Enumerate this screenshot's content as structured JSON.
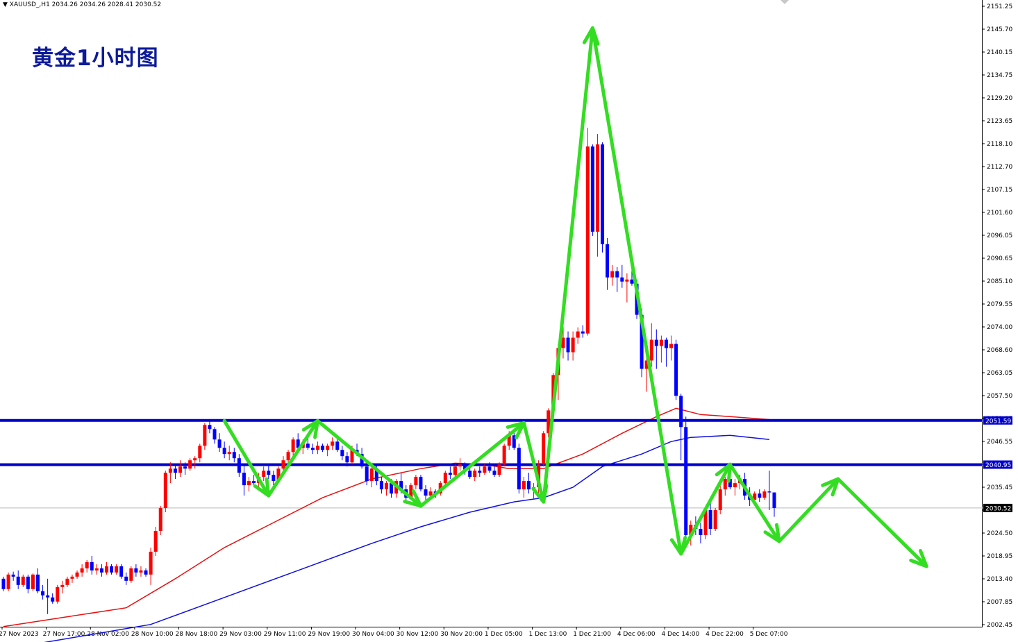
{
  "header": {
    "symbol": "XAUUSD_,H1",
    "ohlc": "2034.26 2034.26 2028.41 2030.52",
    "title": "黄金1小时图"
  },
  "colors": {
    "bull": "#ff0000",
    "bear": "#0000ff",
    "ma_red": "#e81010",
    "ma_blue": "#1010e0",
    "level_line": "#0000cc",
    "arrow": "#33dd22",
    "title": "#0d1a9a"
  },
  "chart_data": {
    "type": "candlestick",
    "ylim": [
      2002.45,
      2151.25
    ],
    "y_ticks": [
      "2151.25",
      "2145.70",
      "2140.15",
      "2134.75",
      "2129.20",
      "2123.65",
      "2118.10",
      "2112.70",
      "2107.15",
      "2101.60",
      "2096.05",
      "2090.65",
      "2085.10",
      "2079.55",
      "2074.00",
      "2068.60",
      "2063.05",
      "2057.50",
      "2051.95",
      "2046.55",
      "2041.00",
      "2035.45",
      "2029.90",
      "2024.50",
      "2018.95",
      "2013.40",
      "2007.85",
      "2002.45"
    ],
    "x_ticks": [
      "27 Nov 2023",
      "27 Nov 17:00",
      "28 Nov 02:00",
      "28 Nov 10:00",
      "28 Nov 18:00",
      "29 Nov 03:00",
      "29 Nov 11:00",
      "29 Nov 19:00",
      "30 Nov 04:00",
      "30 Nov 12:00",
      "30 Nov 20:00",
      "1 Dec 05:00",
      "1 Dec 13:00",
      "1 Dec 21:00",
      "4 Dec 06:00",
      "4 Dec 14:00",
      "4 Dec 22:00",
      "5 Dec 07:00"
    ],
    "x_tick_index": [
      0,
      9,
      18,
      27,
      36,
      45,
      54,
      63,
      72,
      81,
      90,
      99,
      108,
      117,
      126,
      135,
      144,
      153
    ],
    "levels": [
      {
        "value": "2051.59",
        "num": 2051.59
      },
      {
        "value": "2040.95",
        "num": 2040.95
      }
    ],
    "current_price": {
      "value": "2030.52",
      "num": 2030.52
    },
    "candles": [
      [
        2013.5,
        2014.0,
        2010.5,
        2011.0
      ],
      [
        2011.0,
        2015.0,
        2010.5,
        2014.5
      ],
      [
        2014.5,
        2015.2,
        2013.0,
        2014.0
      ],
      [
        2014.0,
        2015.5,
        2011.0,
        2012.0
      ],
      [
        2012.0,
        2014.5,
        2011.5,
        2014.0
      ],
      [
        2014.0,
        2014.5,
        2010.0,
        2011.0
      ],
      [
        2011.0,
        2014.8,
        2010.5,
        2014.5
      ],
      [
        2014.5,
        2016.0,
        2010.0,
        2010.5
      ],
      [
        2010.5,
        2012.0,
        2008.5,
        2009.5
      ],
      [
        2009.5,
        2013.5,
        2005.0,
        2009.0
      ],
      [
        2009.0,
        2010.0,
        2007.5,
        2008.0
      ],
      [
        2008.0,
        2012.0,
        2007.5,
        2011.5
      ],
      [
        2011.5,
        2013.0,
        2010.0,
        2012.0
      ],
      [
        2012.0,
        2014.0,
        2011.5,
        2013.5
      ],
      [
        2013.5,
        2014.5,
        2012.5,
        2014.0
      ],
      [
        2014.0,
        2015.5,
        2013.5,
        2015.0
      ],
      [
        2015.0,
        2017.0,
        2014.0,
        2016.0
      ],
      [
        2016.0,
        2018.0,
        2015.0,
        2017.5
      ],
      [
        2017.5,
        2019.0,
        2014.5,
        2015.5
      ],
      [
        2015.5,
        2017.0,
        2014.5,
        2016.0
      ],
      [
        2016.0,
        2017.0,
        2014.0,
        2015.0
      ],
      [
        2015.0,
        2017.5,
        2014.5,
        2016.5
      ],
      [
        2016.5,
        2017.0,
        2014.5,
        2015.0
      ],
      [
        2015.0,
        2017.0,
        2014.5,
        2016.5
      ],
      [
        2016.5,
        2017.0,
        2013.5,
        2014.0
      ],
      [
        2014.0,
        2015.0,
        2012.0,
        2013.0
      ],
      [
        2013.0,
        2016.5,
        2012.5,
        2016.0
      ],
      [
        2016.0,
        2017.0,
        2014.0,
        2015.0
      ],
      [
        2015.0,
        2016.5,
        2014.0,
        2015.5
      ],
      [
        2015.5,
        2016.0,
        2014.0,
        2014.5
      ],
      [
        2014.5,
        2021.0,
        2012.0,
        2020.0
      ],
      [
        2020.0,
        2026.0,
        2019.0,
        2025.0
      ],
      [
        2025.0,
        2031.0,
        2024.0,
        2030.5
      ],
      [
        2030.5,
        2039.5,
        2029.5,
        2039.0
      ],
      [
        2039.0,
        2041.5,
        2036.5,
        2040.0
      ],
      [
        2040.0,
        2041.0,
        2037.5,
        2039.0
      ],
      [
        2039.0,
        2042.0,
        2038.0,
        2040.5
      ],
      [
        2040.5,
        2041.5,
        2038.5,
        2040.0
      ],
      [
        2040.0,
        2042.5,
        2039.5,
        2042.0
      ],
      [
        2042.0,
        2043.0,
        2040.0,
        2042.5
      ],
      [
        2042.5,
        2046.0,
        2041.5,
        2045.5
      ],
      [
        2045.5,
        2051.0,
        2044.5,
        2050.5
      ],
      [
        2050.5,
        2051.5,
        2048.5,
        2049.5
      ],
      [
        2049.5,
        2050.0,
        2046.0,
        2047.0
      ],
      [
        2047.0,
        2048.5,
        2044.0,
        2045.0
      ],
      [
        2045.0,
        2046.5,
        2042.5,
        2043.5
      ],
      [
        2043.5,
        2045.5,
        2042.0,
        2044.0
      ],
      [
        2044.0,
        2045.0,
        2041.5,
        2042.5
      ],
      [
        2042.5,
        2043.5,
        2038.0,
        2039.0
      ],
      [
        2039.0,
        2041.0,
        2033.5,
        2036.0
      ],
      [
        2036.0,
        2038.0,
        2034.5,
        2037.0
      ],
      [
        2037.0,
        2038.5,
        2035.5,
        2036.5
      ],
      [
        2036.5,
        2039.0,
        2035.5,
        2038.0
      ],
      [
        2038.0,
        2040.5,
        2037.0,
        2039.5
      ],
      [
        2039.5,
        2041.0,
        2037.5,
        2038.5
      ],
      [
        2038.5,
        2039.5,
        2036.0,
        2037.0
      ],
      [
        2037.0,
        2040.5,
        2036.5,
        2040.0
      ],
      [
        2040.0,
        2043.0,
        2039.0,
        2042.0
      ],
      [
        2042.0,
        2044.5,
        2041.0,
        2044.0
      ],
      [
        2044.0,
        2047.5,
        2043.0,
        2047.0
      ],
      [
        2047.0,
        2048.5,
        2044.0,
        2045.0
      ],
      [
        2045.0,
        2047.0,
        2043.5,
        2046.0
      ],
      [
        2046.0,
        2047.5,
        2044.5,
        2045.0
      ],
      [
        2045.0,
        2046.0,
        2043.5,
        2044.5
      ],
      [
        2044.5,
        2046.5,
        2043.5,
        2045.5
      ],
      [
        2045.5,
        2046.0,
        2044.0,
        2044.5
      ],
      [
        2044.5,
        2046.0,
        2043.0,
        2045.5
      ],
      [
        2045.5,
        2047.5,
        2044.5,
        2046.5
      ],
      [
        2046.5,
        2047.0,
        2044.0,
        2044.5
      ],
      [
        2044.5,
        2045.5,
        2042.0,
        2043.0
      ],
      [
        2043.0,
        2044.0,
        2040.5,
        2041.5
      ],
      [
        2041.5,
        2045.5,
        2041.0,
        2044.5
      ],
      [
        2044.5,
        2046.0,
        2043.0,
        2043.5
      ],
      [
        2043.5,
        2045.0,
        2040.0,
        2040.5
      ],
      [
        2040.5,
        2041.5,
        2036.0,
        2037.0
      ],
      [
        2037.0,
        2040.5,
        2035.5,
        2040.0
      ],
      [
        2040.0,
        2041.0,
        2036.0,
        2037.0
      ],
      [
        2037.0,
        2038.0,
        2034.0,
        2035.0
      ],
      [
        2035.0,
        2037.0,
        2033.5,
        2036.5
      ],
      [
        2036.5,
        2037.5,
        2033.0,
        2034.0
      ],
      [
        2034.0,
        2037.5,
        2033.0,
        2037.0
      ],
      [
        2037.0,
        2039.0,
        2034.0,
        2035.0
      ],
      [
        2035.0,
        2036.0,
        2032.0,
        2033.0
      ],
      [
        2033.0,
        2036.5,
        2032.5,
        2036.0
      ],
      [
        2036.0,
        2038.5,
        2035.0,
        2038.0
      ],
      [
        2038.0,
        2038.5,
        2034.5,
        2035.0
      ],
      [
        2035.0,
        2036.0,
        2032.5,
        2033.5
      ],
      [
        2033.5,
        2035.5,
        2032.5,
        2034.5
      ],
      [
        2034.5,
        2035.0,
        2033.0,
        2034.0
      ],
      [
        2034.0,
        2037.0,
        2033.5,
        2036.5
      ],
      [
        2036.5,
        2039.5,
        2036.0,
        2039.0
      ],
      [
        2039.0,
        2040.5,
        2037.5,
        2038.5
      ],
      [
        2038.5,
        2041.0,
        2038.0,
        2040.5
      ],
      [
        2040.5,
        2042.5,
        2039.5,
        2041.0
      ],
      [
        2041.0,
        2041.5,
        2038.5,
        2039.5
      ],
      [
        2039.5,
        2040.0,
        2037.5,
        2038.0
      ],
      [
        2038.0,
        2040.0,
        2037.0,
        2039.5
      ],
      [
        2039.5,
        2040.5,
        2038.0,
        2039.0
      ],
      [
        2039.0,
        2041.0,
        2038.5,
        2040.5
      ],
      [
        2040.5,
        2041.5,
        2039.0,
        2039.5
      ],
      [
        2039.5,
        2040.5,
        2038.0,
        2038.5
      ],
      [
        2038.5,
        2041.5,
        2038.0,
        2041.0
      ],
      [
        2041.0,
        2046.0,
        2040.5,
        2045.5
      ],
      [
        2045.5,
        2049.0,
        2044.5,
        2048.0
      ],
      [
        2048.0,
        2049.5,
        2044.5,
        2045.0
      ],
      [
        2045.0,
        2046.0,
        2034.0,
        2035.0
      ],
      [
        2035.0,
        2038.0,
        2033.0,
        2037.0
      ],
      [
        2037.0,
        2039.0,
        2034.0,
        2035.0
      ],
      [
        2035.0,
        2036.5,
        2032.5,
        2035.5
      ],
      [
        2035.5,
        2042.0,
        2033.0,
        2041.0
      ],
      [
        2041.0,
        2049.0,
        2040.5,
        2048.5
      ],
      [
        2048.5,
        2054.5,
        2047.5,
        2054.0
      ],
      [
        2054.0,
        2063.0,
        2053.5,
        2062.5
      ],
      [
        2062.5,
        2070.0,
        2056.5,
        2069.0
      ],
      [
        2069.0,
        2076.0,
        2066.5,
        2071.5
      ],
      [
        2071.5,
        2073.0,
        2066.0,
        2068.0
      ],
      [
        2068.0,
        2073.0,
        2066.0,
        2071.5
      ],
      [
        2071.5,
        2074.0,
        2070.0,
        2073.0
      ],
      [
        2073.0,
        2074.5,
        2071.5,
        2072.5
      ],
      [
        2072.5,
        2122.0,
        2072.0,
        2117.5
      ],
      [
        2117.5,
        2118.0,
        2096.0,
        2097.0
      ],
      [
        2097.0,
        2120.5,
        2091.0,
        2118.0
      ],
      [
        2118.0,
        2118.5,
        2092.0,
        2094.0
      ],
      [
        2094.0,
        2095.5,
        2083.0,
        2086.0
      ],
      [
        2086.0,
        2089.0,
        2084.0,
        2087.5
      ],
      [
        2087.5,
        2088.5,
        2082.5,
        2086.0
      ],
      [
        2086.0,
        2089.0,
        2083.5,
        2085.0
      ],
      [
        2085.0,
        2087.0,
        2080.0,
        2085.5
      ],
      [
        2085.5,
        2090.0,
        2084.0,
        2084.5
      ],
      [
        2084.5,
        2085.5,
        2076.0,
        2077.0
      ],
      [
        2077.0,
        2078.5,
        2062.0,
        2064.0
      ],
      [
        2064.0,
        2069.5,
        2058.5,
        2066.0
      ],
      [
        2066.0,
        2075.0,
        2064.5,
        2071.0
      ],
      [
        2071.0,
        2073.5,
        2064.0,
        2069.5
      ],
      [
        2069.5,
        2072.0,
        2065.5,
        2071.0
      ],
      [
        2071.0,
        2071.5,
        2064.5,
        2069.0
      ],
      [
        2069.0,
        2072.0,
        2066.0,
        2070.0
      ],
      [
        2070.0,
        2071.0,
        2056.5,
        2057.5
      ],
      [
        2057.5,
        2058.0,
        2042.0,
        2050.0
      ],
      [
        2050.0,
        2052.5,
        2023.0,
        2024.0
      ],
      [
        2024.0,
        2027.5,
        2021.5,
        2026.5
      ],
      [
        2026.5,
        2028.5,
        2024.0,
        2025.5
      ],
      [
        2025.5,
        2027.0,
        2022.0,
        2024.0
      ],
      [
        2024.0,
        2030.5,
        2023.0,
        2030.0
      ],
      [
        2030.0,
        2032.5,
        2024.0,
        2025.5
      ],
      [
        2025.5,
        2030.5,
        2025.0,
        2030.0
      ],
      [
        2030.0,
        2036.0,
        2029.0,
        2035.0
      ],
      [
        2035.0,
        2038.0,
        2033.5,
        2037.5
      ],
      [
        2037.5,
        2038.5,
        2035.0,
        2035.5
      ],
      [
        2035.5,
        2037.5,
        2033.5,
        2036.5
      ],
      [
        2036.5,
        2038.5,
        2035.0,
        2037.5
      ],
      [
        2037.5,
        2039.0,
        2032.5,
        2033.5
      ],
      [
        2033.5,
        2035.5,
        2031.0,
        2032.5
      ],
      [
        2032.5,
        2034.5,
        2031.5,
        2034.0
      ],
      [
        2034.0,
        2035.0,
        2032.0,
        2033.0
      ],
      [
        2033.0,
        2035.0,
        2032.5,
        2034.5
      ],
      [
        2034.5,
        2039.5,
        2030.0,
        2034.26
      ],
      [
        2034.26,
        2034.26,
        2028.41,
        2030.52
      ]
    ],
    "ma_red": [
      [
        0,
        2002.0
      ],
      [
        25,
        2006.5
      ],
      [
        35,
        2013.5
      ],
      [
        45,
        2021.0
      ],
      [
        55,
        2027.0
      ],
      [
        65,
        2033.0
      ],
      [
        75,
        2037.5
      ],
      [
        85,
        2040.0
      ],
      [
        92,
        2041.3
      ],
      [
        98,
        2041.0
      ],
      [
        103,
        2040.0
      ],
      [
        110,
        2040.0
      ],
      [
        118,
        2043.5
      ],
      [
        126,
        2048.5
      ],
      [
        133,
        2052.5
      ],
      [
        137,
        2054.5
      ],
      [
        142,
        2053.0
      ],
      [
        148,
        2052.5
      ],
      [
        156,
        2051.8
      ]
    ],
    "ma_blue": [
      [
        0,
        1996.5
      ],
      [
        30,
        2002.5
      ],
      [
        45,
        2009.0
      ],
      [
        60,
        2015.5
      ],
      [
        75,
        2022.0
      ],
      [
        85,
        2026.0
      ],
      [
        95,
        2029.5
      ],
      [
        104,
        2032.0
      ],
      [
        110,
        2033.0
      ],
      [
        116,
        2035.5
      ],
      [
        122,
        2040.5
      ],
      [
        130,
        2043.5
      ],
      [
        136,
        2046.5
      ],
      [
        140,
        2047.5
      ],
      [
        148,
        2048.0
      ],
      [
        156,
        2047.0
      ]
    ],
    "arrows": [
      [
        [
          45,
          2051.5
        ],
        [
          54,
          2033.5
        ]
      ],
      [
        [
          54,
          2033.5
        ],
        [
          64,
          2051.5
        ]
      ],
      [
        [
          64,
          2051.5
        ],
        [
          85,
          2031.0
        ]
      ],
      [
        [
          85,
          2031.0
        ],
        [
          106,
          2051.0
        ]
      ],
      [
        [
          106,
          2051.0
        ],
        [
          110,
          2032.0
        ]
      ],
      [
        [
          110,
          2032.0
        ],
        [
          120,
          2146.0
        ]
      ],
      [
        [
          120,
          2146.0
        ],
        [
          138,
          2019.5
        ]
      ],
      [
        [
          138,
          2019.5
        ],
        [
          148,
          2041.0
        ]
      ],
      [
        [
          148,
          2041.0
        ],
        [
          158,
          2022.5
        ]
      ],
      [
        [
          158,
          2022.5
        ],
        [
          170,
          2037.5
        ]
      ],
      [
        [
          170,
          2037.5
        ],
        [
          188,
          2016.5
        ]
      ]
    ]
  }
}
